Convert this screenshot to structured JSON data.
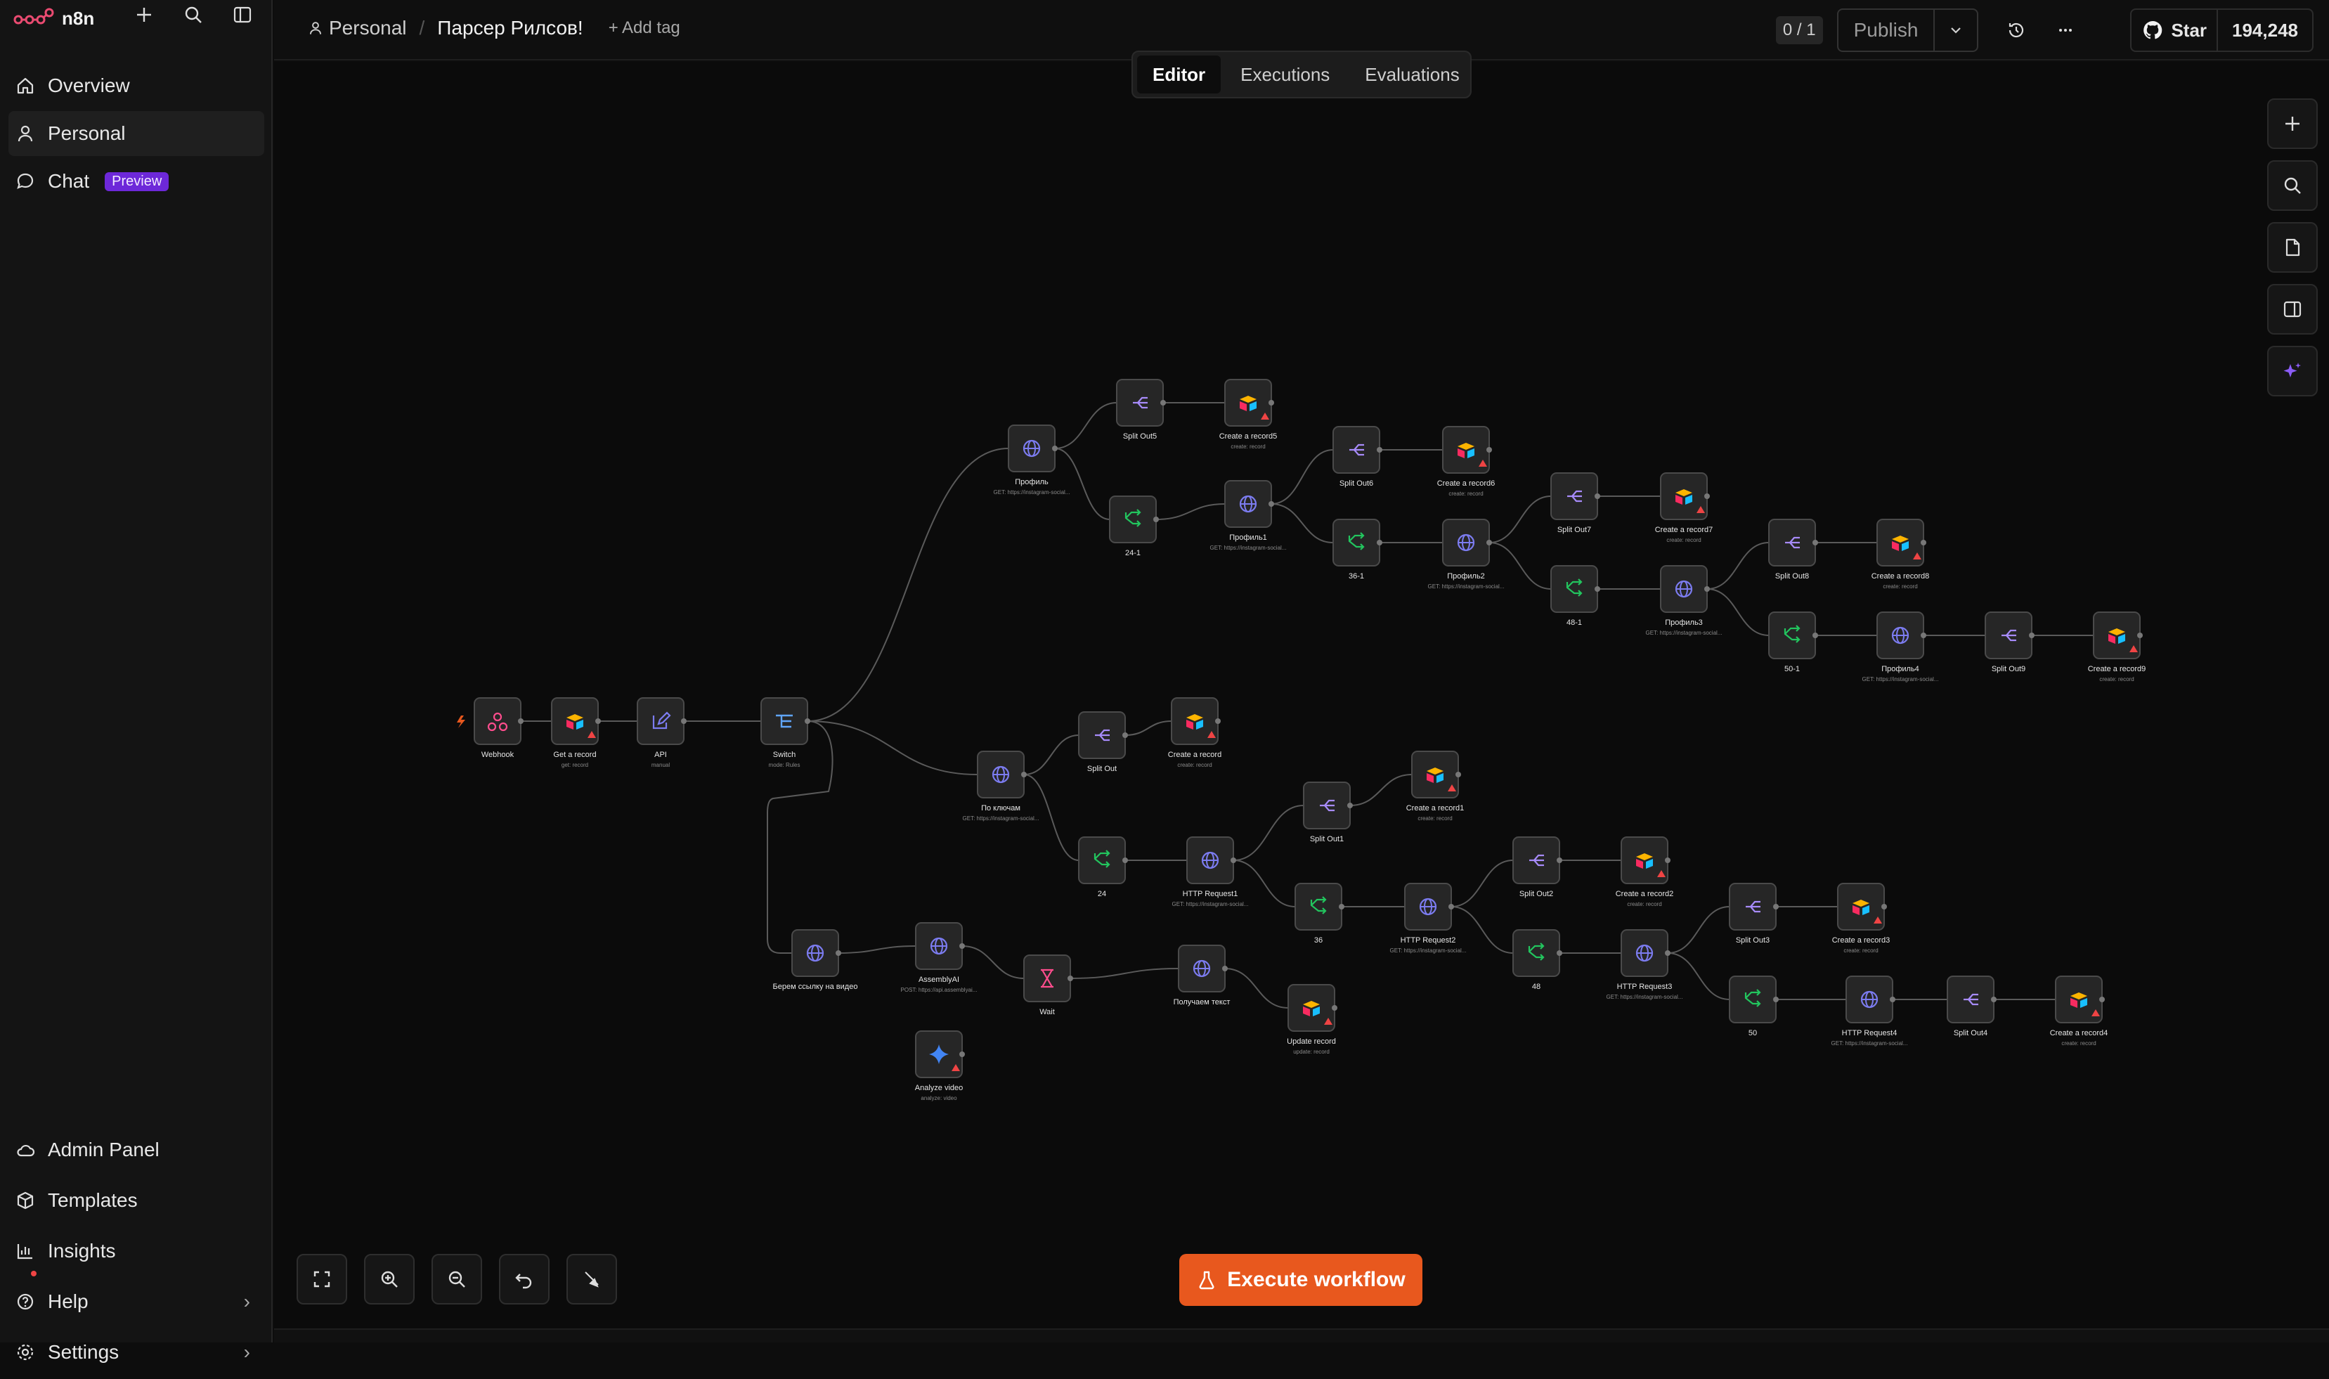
{
  "app": {
    "brand": "n8n"
  },
  "sidebar": {
    "items": [
      {
        "label": "Overview",
        "icon": "home-icon"
      },
      {
        "label": "Personal",
        "icon": "user-icon"
      },
      {
        "label": "Chat",
        "icon": "chat-icon",
        "badge": "Preview"
      }
    ],
    "bottom_items": [
      {
        "label": "Admin Panel",
        "icon": "cloud-icon"
      },
      {
        "label": "Templates",
        "icon": "box-icon"
      },
      {
        "label": "Insights",
        "icon": "chart-icon"
      },
      {
        "label": "Help",
        "icon": "help-icon"
      },
      {
        "label": "Settings",
        "icon": "settings-icon"
      }
    ]
  },
  "header": {
    "project": "Personal",
    "workflow_name": "Парсер Рилсов!",
    "add_tag": "+ Add tag",
    "counter": "0 / 1",
    "publish": "Publish",
    "star": "Star",
    "star_count": "194,248"
  },
  "tabs": [
    {
      "label": "Editor",
      "active": true
    },
    {
      "label": "Executions",
      "active": false
    },
    {
      "label": "Evaluations",
      "active": false
    }
  ],
  "execute_button": "Execute workflow",
  "colors": {
    "accent": "#e8581e",
    "http": "#7c7cf0",
    "split": "#a78bfa",
    "if": "#22c55e",
    "switch": "#60a5fa",
    "webhook": "#ff4d8d"
  },
  "nodes": [
    {
      "id": "webhook",
      "label": "Webhook",
      "sub": "",
      "type": "webhook"
    },
    {
      "id": "getrec",
      "label": "Get a record",
      "sub": "get: record",
      "type": "airtable"
    },
    {
      "id": "api",
      "label": "API",
      "sub": "manual",
      "type": "edit"
    },
    {
      "id": "switch",
      "label": "Switch",
      "sub": "mode: Rules",
      "type": "switch"
    },
    {
      "id": "prof",
      "label": "Профиль",
      "sub": "GET: https://instagram-social...",
      "type": "http"
    },
    {
      "id": "so5",
      "label": "Split Out5",
      "sub": "",
      "type": "split"
    },
    {
      "id": "cr5",
      "label": "Create a record5",
      "sub": "create: record",
      "type": "airtable"
    },
    {
      "id": "if241",
      "label": "24-1",
      "sub": "",
      "type": "if"
    },
    {
      "id": "prof1",
      "label": "Профиль1",
      "sub": "GET: https://instagram-social...",
      "type": "http"
    },
    {
      "id": "so6",
      "label": "Split Out6",
      "sub": "",
      "type": "split"
    },
    {
      "id": "cr6",
      "label": "Create a record6",
      "sub": "create: record",
      "type": "airtable"
    },
    {
      "id": "if361",
      "label": "36-1",
      "sub": "",
      "type": "if"
    },
    {
      "id": "prof2",
      "label": "Профиль2",
      "sub": "GET: https://instagram-social...",
      "type": "http"
    },
    {
      "id": "so7",
      "label": "Split Out7",
      "sub": "",
      "type": "split"
    },
    {
      "id": "cr7",
      "label": "Create a record7",
      "sub": "create: record",
      "type": "airtable"
    },
    {
      "id": "if481",
      "label": "48-1",
      "sub": "",
      "type": "if"
    },
    {
      "id": "prof3",
      "label": "Профиль3",
      "sub": "GET: https://instagram-social...",
      "type": "http"
    },
    {
      "id": "so8",
      "label": "Split Out8",
      "sub": "",
      "type": "split"
    },
    {
      "id": "cr8",
      "label": "Create a record8",
      "sub": "create: record",
      "type": "airtable"
    },
    {
      "id": "if501",
      "label": "50-1",
      "sub": "",
      "type": "if"
    },
    {
      "id": "prof4",
      "label": "Профиль4",
      "sub": "GET: https://instagram-social...",
      "type": "http"
    },
    {
      "id": "so9",
      "label": "Split Out9",
      "sub": "",
      "type": "split"
    },
    {
      "id": "cr9",
      "label": "Create a record9",
      "sub": "create: record",
      "type": "airtable"
    },
    {
      "id": "keys",
      "label": "По ключам",
      "sub": "GET: https://instagram-social...",
      "type": "http"
    },
    {
      "id": "so",
      "label": "Split Out",
      "sub": "",
      "type": "split"
    },
    {
      "id": "cr",
      "label": "Create a record",
      "sub": "create: record",
      "type": "airtable"
    },
    {
      "id": "if24",
      "label": "24",
      "sub": "",
      "type": "if"
    },
    {
      "id": "hr1",
      "label": "HTTP Request1",
      "sub": "GET: https://instagram-social...",
      "type": "http"
    },
    {
      "id": "so1",
      "label": "Split Out1",
      "sub": "",
      "type": "split"
    },
    {
      "id": "cr1",
      "label": "Create a record1",
      "sub": "create: record",
      "type": "airtable"
    },
    {
      "id": "if36",
      "label": "36",
      "sub": "",
      "type": "if"
    },
    {
      "id": "hr2",
      "label": "HTTP Request2",
      "sub": "GET: https://instagram-social...",
      "type": "http"
    },
    {
      "id": "so2",
      "label": "Split Out2",
      "sub": "",
      "type": "split"
    },
    {
      "id": "cr2",
      "label": "Create a record2",
      "sub": "create: record",
      "type": "airtable"
    },
    {
      "id": "if48",
      "label": "48",
      "sub": "",
      "type": "if"
    },
    {
      "id": "hr3",
      "label": "HTTP Request3",
      "sub": "GET: https://instagram-social...",
      "type": "http"
    },
    {
      "id": "so3",
      "label": "Split Out3",
      "sub": "",
      "type": "split"
    },
    {
      "id": "cr3",
      "label": "Create a record3",
      "sub": "create: record",
      "type": "airtable"
    },
    {
      "id": "if50",
      "label": "50",
      "sub": "",
      "type": "if"
    },
    {
      "id": "hr4",
      "label": "HTTP Request4",
      "sub": "GET: https://instagram-social...",
      "type": "http"
    },
    {
      "id": "so4",
      "label": "Split Out4",
      "sub": "",
      "type": "split"
    },
    {
      "id": "cr4",
      "label": "Create a record4",
      "sub": "create: record",
      "type": "airtable"
    },
    {
      "id": "link",
      "label": "Берем ссылку на видео",
      "sub": "",
      "type": "http"
    },
    {
      "id": "aai",
      "label": "AssemblyAI",
      "sub": "POST: https://api.assemblyai...",
      "type": "http"
    },
    {
      "id": "wait",
      "label": "Wait",
      "sub": "",
      "type": "wait"
    },
    {
      "id": "text",
      "label": "Получаем текст",
      "sub": "",
      "type": "http"
    },
    {
      "id": "upd",
      "label": "Update record",
      "sub": "update: record",
      "type": "airtable"
    },
    {
      "id": "analyze",
      "label": "Analyze video",
      "sub": "analyze: video",
      "type": "gemini"
    }
  ]
}
